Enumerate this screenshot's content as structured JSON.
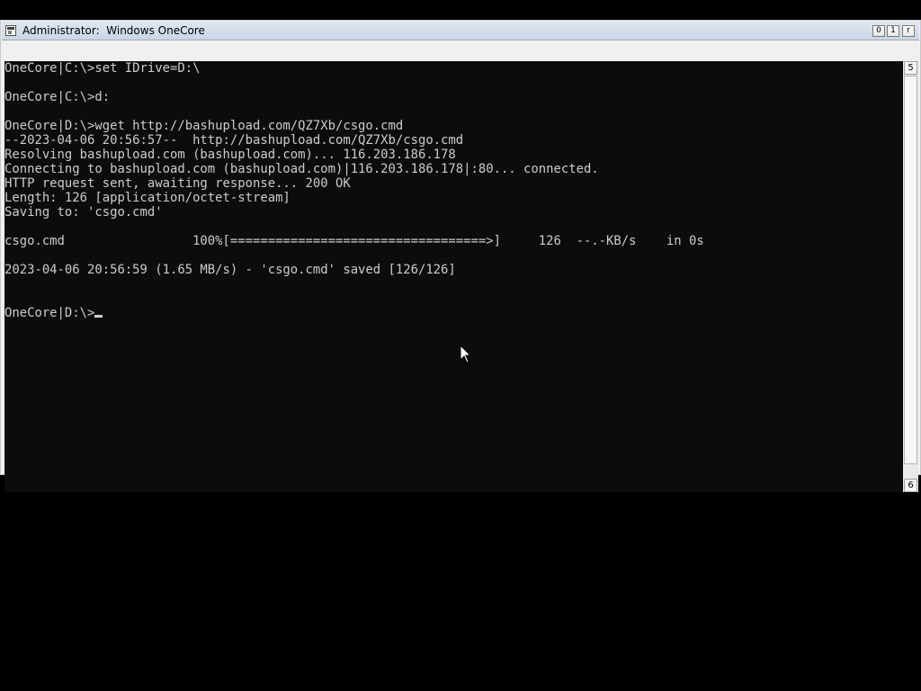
{
  "window": {
    "title": "Administrator:  Windows OneCore",
    "buttons": {
      "minimize": "0",
      "maximize": "1",
      "close": "r"
    }
  },
  "console": {
    "lines": [
      "OneCore|C:\\>set IDrive=D:\\",
      "",
      "OneCore|C:\\>d:",
      "",
      "OneCore|D:\\>wget http://bashupload.com/QZ7Xb/csgo.cmd",
      "--2023-04-06 20:56:57--  http://bashupload.com/QZ7Xb/csgo.cmd",
      "Resolving bashupload.com (bashupload.com)... 116.203.186.178",
      "Connecting to bashupload.com (bashupload.com)|116.203.186.178|:80... connected.",
      "HTTP request sent, awaiting response... 200 OK",
      "Length: 126 [application/octet-stream]",
      "Saving to: 'csgo.cmd'",
      "",
      "csgo.cmd                 100%[==================================>]     126  --.-KB/s    in 0s",
      "",
      "2023-04-06 20:56:59 (1.65 MB/s) - 'csgo.cmd' saved [126/126]",
      "",
      "",
      "OneCore|D:\\>"
    ],
    "text_color": "#cccccc",
    "background_color": "#0c0c0c"
  },
  "scrollbar": {
    "up_glyph": "5",
    "down_glyph": "6"
  },
  "icons": {
    "app": "console-icon",
    "pointer": "mouse-pointer-icon"
  }
}
